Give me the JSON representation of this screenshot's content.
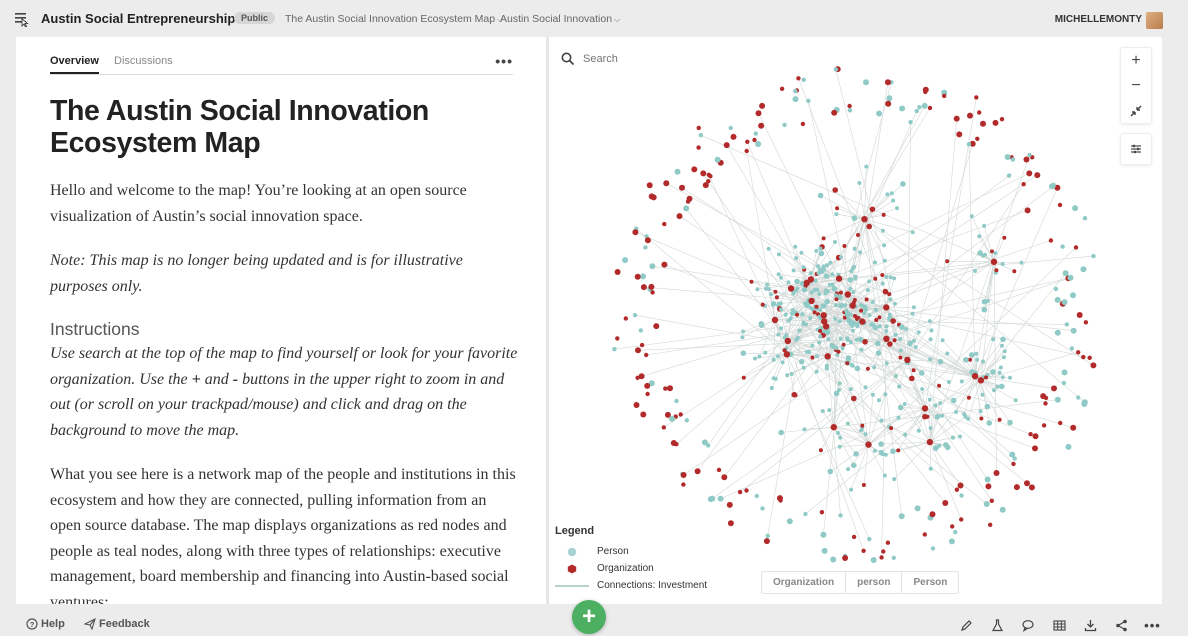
{
  "topbar": {
    "project_title": "Austin Social Entrepreneurship",
    "visibility_badge": "Public",
    "breadcrumb_map": "The Austin Social Innovation Ecosystem Map",
    "breadcrumb_view": "Austin Social Innovation",
    "username": "MICHELLEMONTY"
  },
  "tabs": {
    "overview": "Overview",
    "discussions": "Discussions",
    "more": "•••"
  },
  "article": {
    "title": "The Austin Social Innovation Ecosystem Map",
    "intro": "Hello and welcome to the map! You’re looking at an open source visualization of Austin’s social innovation space.",
    "note": "Note: This map is no longer being updated and is for illustrative purposes only.",
    "instructions_heading": "Instructions",
    "instructions_part1": "Use search at the top of the map to find yourself or look for your favorite organization. Use the ",
    "plus": "+",
    "and": " and ",
    "minus": "-",
    "instructions_part2": " buttons in the upper right to zoom in and out (or scroll on your trackpad/mouse) and click and drag on the background to move the map.",
    "body": "What you see here is a network map of the people and institutions in this ecosystem and how they are connected, pulling information from an open source database. The map displays organizations as red nodes and people as teal nodes, along with three types of relationships: executive management, board membership and financing into Austin-based social ventures;"
  },
  "map": {
    "search_placeholder": "Search",
    "legend": {
      "title": "Legend",
      "person": "Person",
      "organization": "Organization",
      "connections": "Connections: Investment"
    },
    "filters": [
      "Organization",
      "person",
      "Person"
    ],
    "colors": {
      "organization": "#b22a2a",
      "person": "#8fcac6",
      "edge": "#d2d8d6"
    }
  },
  "bottombar": {
    "help": "Help",
    "feedback": "Feedback",
    "add": "+"
  }
}
